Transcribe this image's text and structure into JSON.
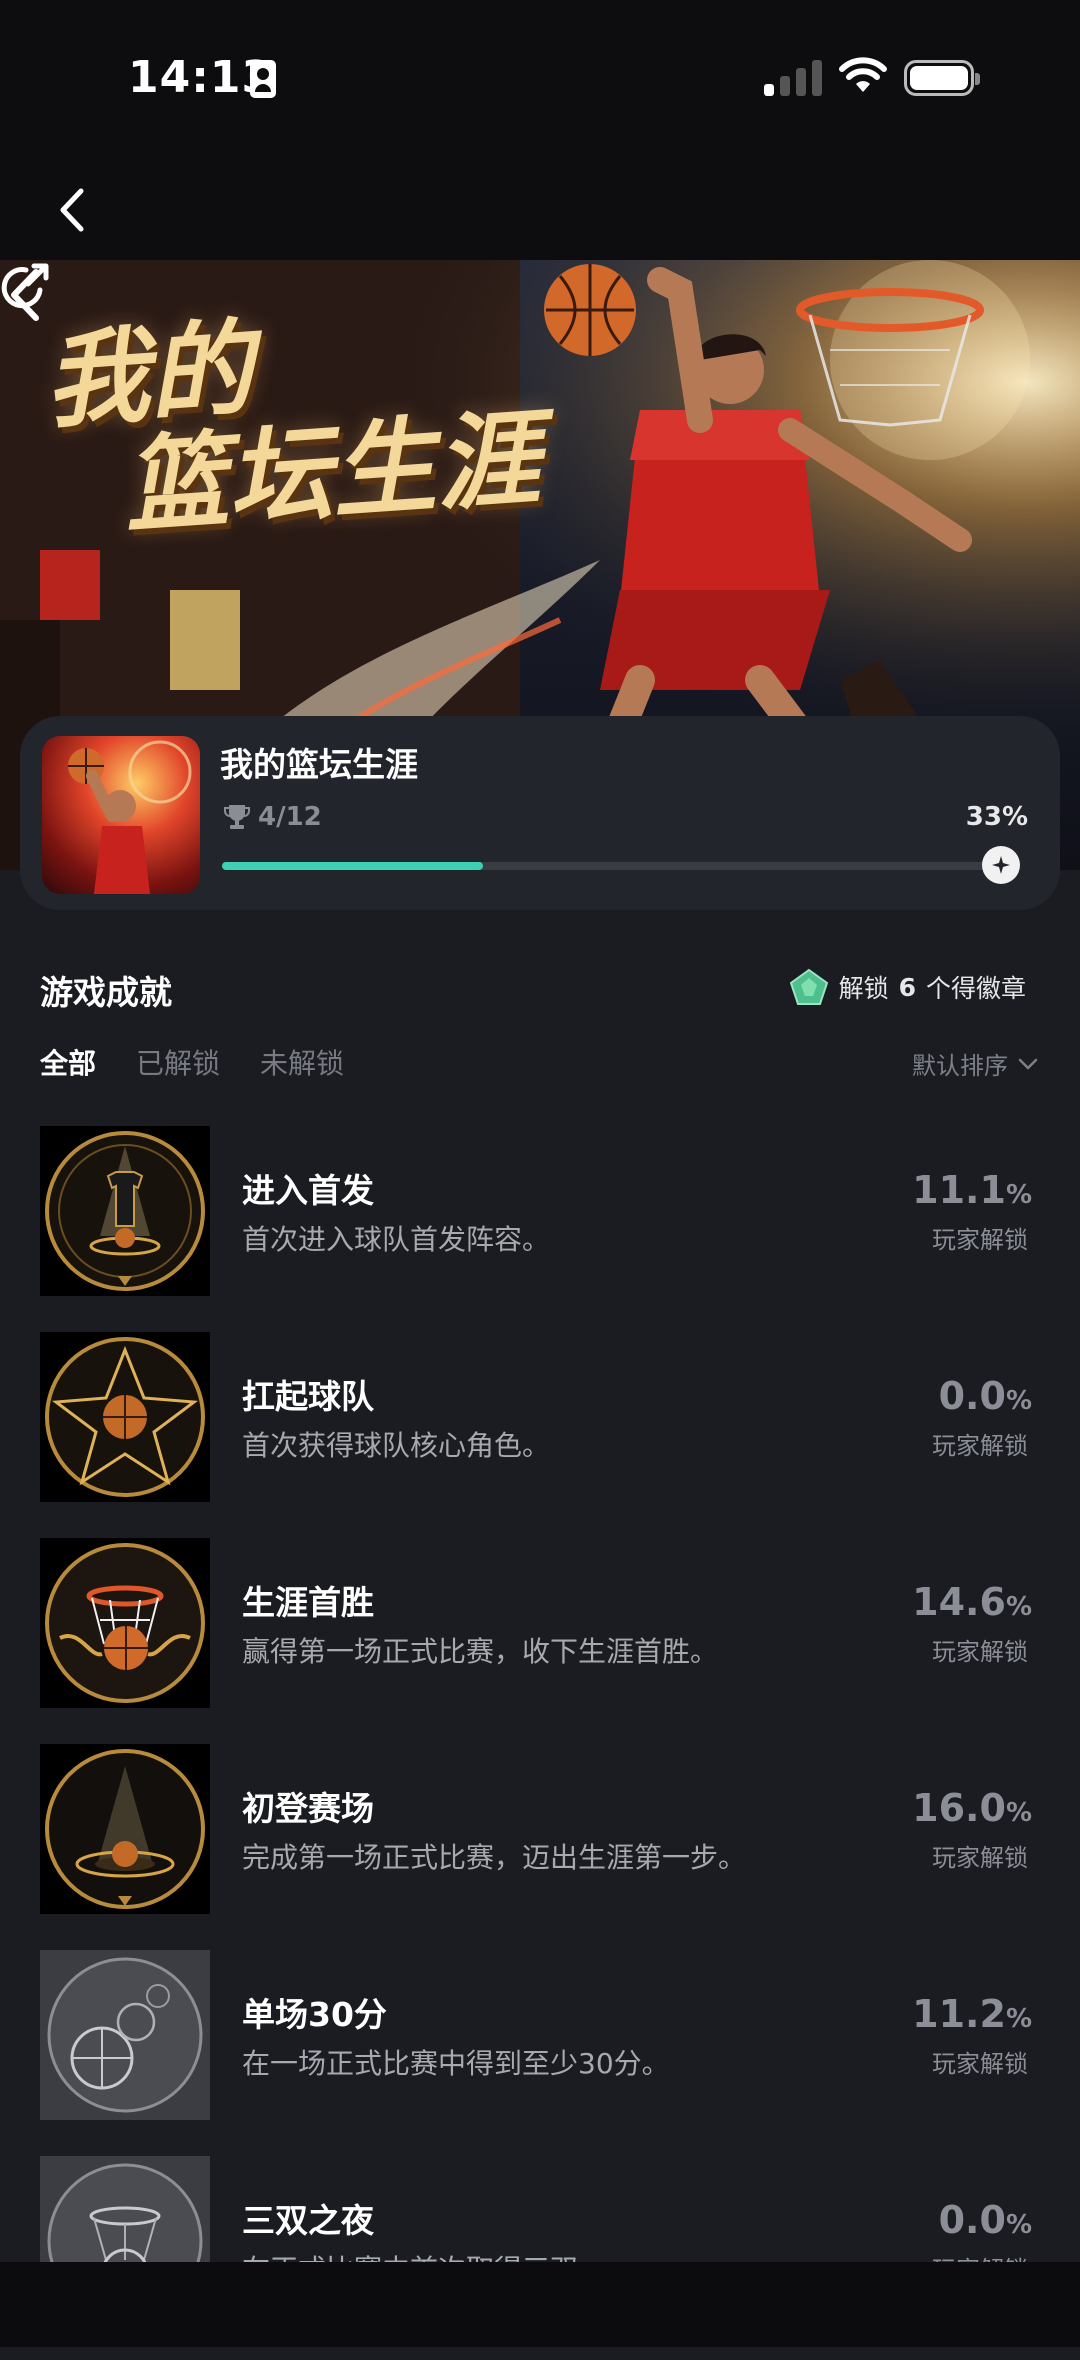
{
  "status_bar": {
    "time": "14:13"
  },
  "banner": {
    "title_line1": "我的",
    "title_line2": "篮坛生涯"
  },
  "game": {
    "name": "我的篮坛生涯",
    "trophy_progress": "4/12",
    "progress_percent": "33%",
    "progress_value": 0.33
  },
  "achievements_section": {
    "title": "游戏成就",
    "badge_prefix": "解锁",
    "badge_count": "6",
    "badge_suffix": "个得徽章",
    "tabs": [
      {
        "label": "全部"
      },
      {
        "label": "已解锁"
      },
      {
        "label": "未解锁"
      }
    ],
    "sort_label": "默认排序"
  },
  "achievements": [
    {
      "name": "进入首发",
      "desc": "首次进入球队首发阵容。",
      "rate": "11.1",
      "unit": "%",
      "rate_label": "玩家解锁",
      "locked": false
    },
    {
      "name": "扛起球队",
      "desc": "首次获得球队核心角色。",
      "rate": "0.0",
      "unit": "%",
      "rate_label": "玩家解锁",
      "locked": false
    },
    {
      "name": "生涯首胜",
      "desc": "赢得第一场正式比赛，收下生涯首胜。",
      "rate": "14.6",
      "unit": "%",
      "rate_label": "玩家解锁",
      "locked": false
    },
    {
      "name": "初登赛场",
      "desc": "完成第一场正式比赛，迈出生涯第一步。",
      "rate": "16.0",
      "unit": "%",
      "rate_label": "玩家解锁",
      "locked": false
    },
    {
      "name": "单场30分",
      "desc": "在一场正式比赛中得到至少30分。",
      "rate": "11.2",
      "unit": "%",
      "rate_label": "玩家解锁",
      "locked": true
    },
    {
      "name": "三双之夜",
      "desc": "在正式比赛中首次取得三双。",
      "rate": "0.0",
      "unit": "%",
      "rate_label": "玩家解锁",
      "locked": true
    }
  ],
  "colors": {
    "accent": "#3fd0b4",
    "background": "#1b1c22",
    "card": "#23252c",
    "muted": "#8b8e97"
  }
}
